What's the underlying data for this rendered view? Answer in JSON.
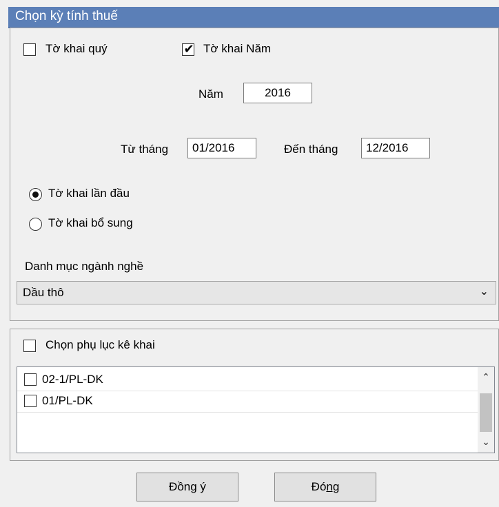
{
  "title": "Chọn kỳ tính thuế",
  "period": {
    "quarterly_label": "Tờ khai quý",
    "quarterly_checked": false,
    "annual_label": "Tờ khai Năm",
    "annual_checked": true,
    "year_label": "Năm",
    "year_value": "2016",
    "from_label": "Từ tháng",
    "from_value": "01/2016",
    "to_label": "Đến tháng",
    "to_value": "12/2016"
  },
  "declaration_type": {
    "first_label": "Tờ khai lần đầu",
    "first_selected": true,
    "supplement_label": "Tờ khai bổ sung",
    "supplement_selected": false
  },
  "industry": {
    "label": "Danh mục ngành nghề",
    "selected": "Dầu thô"
  },
  "appendix": {
    "label": "Chọn phụ lục kê khai",
    "checked": false,
    "items": [
      {
        "label": "02-1/PL-DK",
        "checked": false
      },
      {
        "label": "01/PL-DK",
        "checked": false
      }
    ]
  },
  "buttons": {
    "ok_prefix": "Đồn",
    "ok_underline": "g",
    "ok_suffix": " ý",
    "close_prefix": "Đó",
    "close_underline": "ng"
  },
  "icons": {
    "check": "check-mark-icon",
    "dropdown": "chevron-down-icon",
    "scroll_up": "chevron-up-icon",
    "scroll_down": "chevron-down-icon"
  }
}
